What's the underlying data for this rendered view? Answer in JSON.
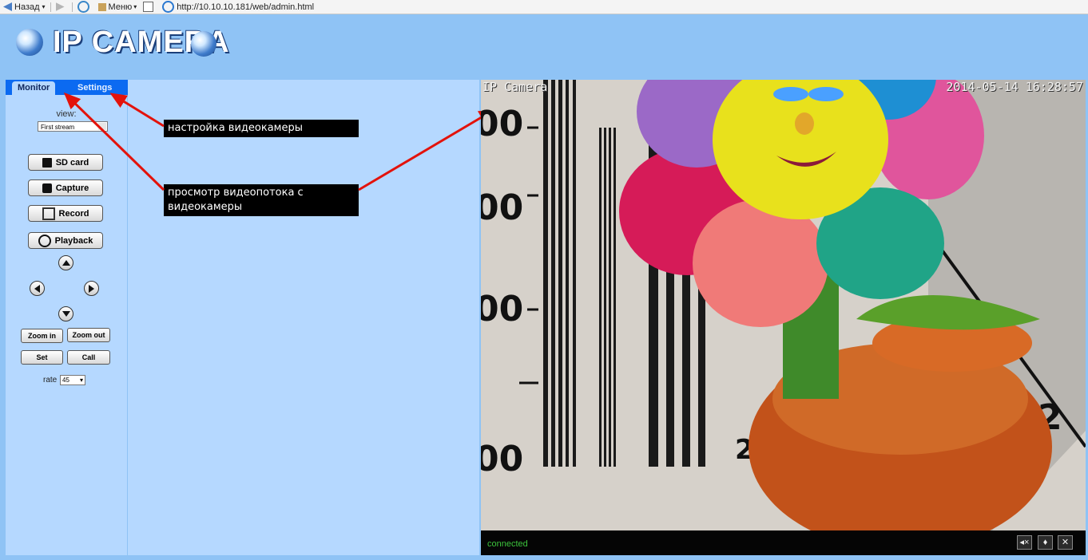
{
  "browser": {
    "back_label": "Назад",
    "menu_label": "Меню",
    "address": "http://10.10.10.181/web/admin.html"
  },
  "header": {
    "brand": "IP CAMERA"
  },
  "tabs": {
    "monitor": "Monitor",
    "settings": "Settings"
  },
  "view": {
    "label": "view:",
    "selected": "First stream"
  },
  "buttons": {
    "sd_card": "SD card",
    "capture": "Capture",
    "record": "Record",
    "playback": "Playback",
    "zoom_in": "Zoom in",
    "zoom_out": "Zoom out",
    "set": "Set",
    "call": "Call"
  },
  "rate": {
    "label": "rate",
    "selected": "45"
  },
  "annotations": {
    "settings_note": "настройка видеокамеры",
    "monitor_note": "просмотр видеопотока с видеокамеры"
  },
  "video": {
    "osd_name": "IP Camera",
    "osd_datetime": "2014-05-14 16:28:57",
    "status": "connected"
  },
  "colors": {
    "page_bg": "#8fc3f5",
    "panel_bg": "#b5d8ff",
    "tab_bar": "#0b6af1",
    "status_green": "#3cc43c"
  }
}
